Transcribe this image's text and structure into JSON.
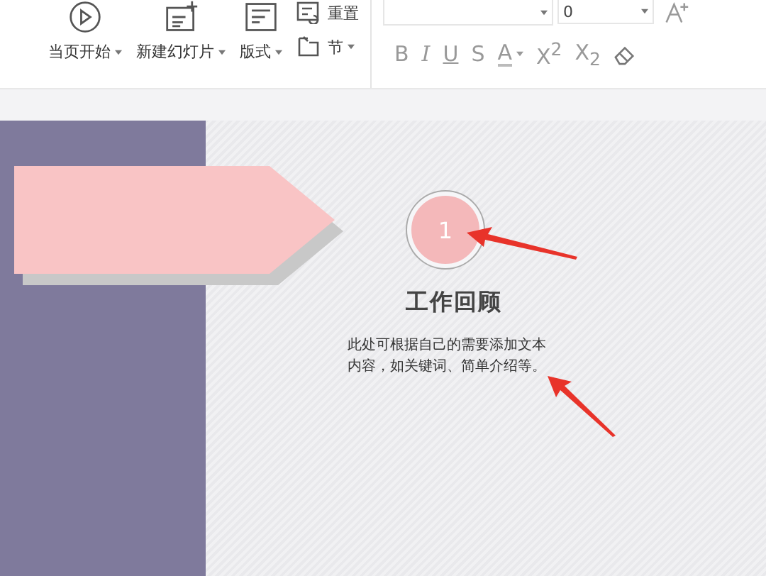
{
  "ribbon": {
    "buttons": [
      {
        "kind": "play",
        "label": "当页开始",
        "dropdown": true
      },
      {
        "kind": "new-slide",
        "label": "新建幻灯片",
        "dropdown": true
      },
      {
        "kind": "layout",
        "label": "版式",
        "dropdown": true
      }
    ],
    "small_buttons": [
      {
        "kind": "reset",
        "label": "重置",
        "dropdown": false
      },
      {
        "kind": "section",
        "label": "节",
        "dropdown": true
      }
    ],
    "font_size": {
      "value": "0"
    },
    "format_buttons": [
      {
        "kind": "bold",
        "label": "B"
      },
      {
        "kind": "italic",
        "label": "I"
      },
      {
        "kind": "underline",
        "label": "U"
      },
      {
        "kind": "strike",
        "label": "S"
      },
      {
        "kind": "color",
        "label": "A"
      },
      {
        "kind": "sup",
        "label": "X$^{2}$"
      },
      {
        "kind": "sub",
        "label": "X$_{2}$"
      },
      {
        "kind": "eraser"
      }
    ]
  },
  "slide": {
    "number": "1",
    "title": "工作回顾",
    "body": "此处可根据自己的需要添加文本内容，如关键词、简单介绍等。"
  }
}
